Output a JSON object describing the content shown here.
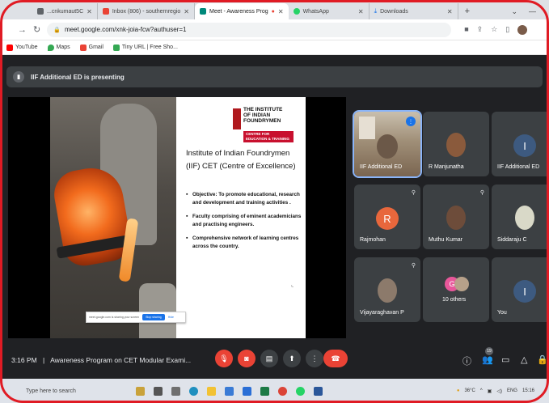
{
  "browser": {
    "tabs": [
      {
        "label": "...cnkumaut5C",
        "active": false,
        "color": "#5f6368"
      },
      {
        "label": "Inbox (806) - southernregio",
        "active": false,
        "color": "#ea4335"
      },
      {
        "label": "Meet - Awareness Prog",
        "active": true,
        "color": "#00897b"
      },
      {
        "label": "WhatsApp",
        "active": false,
        "color": "#25d366"
      },
      {
        "label": "Downloads",
        "active": false,
        "color": "#1a73e8"
      }
    ],
    "new_tab": "+",
    "url": "meet.google.com/xnk-joia-fcw?authuser=1",
    "bookmarks": [
      {
        "label": "YouTube",
        "color": "#ff0000"
      },
      {
        "label": "Maps",
        "color": "#34a853"
      },
      {
        "label": "Gmail",
        "color": "#ea4335"
      },
      {
        "label": "Tiny URL | Free Sho...",
        "color": "#34a853"
      }
    ]
  },
  "meet": {
    "presenting_banner": "IIF Additional ED is presenting",
    "slide": {
      "logo_line1": "THE INSTITUTE",
      "logo_line2": "OF INDIAN",
      "logo_line3": "FOUNDRYMEN",
      "logo_strip": "CENTRE FOR EDUCATION & TRAINING",
      "title": "Institute of Indian Foundrymen (IIF) CET (Centre of Excellence)",
      "bullets": [
        "Objective: To promote educational, research and development and training activities .",
        "Faculty comprising of eminent academicians and practising engineers.",
        "Comprehensive network of learning centres across the country."
      ],
      "share_text": "meet.google.com is sharing your screen",
      "stop_label": "Stop sharing",
      "hide_label": "Hide"
    },
    "participants": [
      {
        "name": "IIF Additional ED",
        "kind": "video",
        "speaking": true
      },
      {
        "name": "R Manjunatha",
        "kind": "photo",
        "photo_color": "#8a5a3c"
      },
      {
        "name": "IIF Additional ED",
        "kind": "letter",
        "letter": "I",
        "color": "#3d5a80"
      },
      {
        "name": "Rajmohan",
        "kind": "letter",
        "letter": "R",
        "color": "#e8673c"
      },
      {
        "name": "Muthu Kumar",
        "kind": "photo",
        "photo_color": "#6d4c3a"
      },
      {
        "name": "Siddaraju C",
        "kind": "photo",
        "photo_color": "#d9d9c8"
      },
      {
        "name": "Vijayaraghavan P",
        "kind": "photo",
        "photo_color": "#8c7a6b"
      },
      {
        "name": "10 others",
        "kind": "others",
        "letter": "G"
      },
      {
        "name": "You",
        "kind": "letter",
        "letter": "I",
        "color": "#3d5a80"
      }
    ],
    "bottom": {
      "time": "3:16 PM",
      "separator": "|",
      "meeting_title": "Awareness Program on CET Modular Exami...",
      "people_count": "19"
    }
  },
  "taskbar": {
    "search_placeholder": "Type here to search",
    "temperature": "36°C",
    "language": "ENG",
    "clock": "15:16"
  }
}
